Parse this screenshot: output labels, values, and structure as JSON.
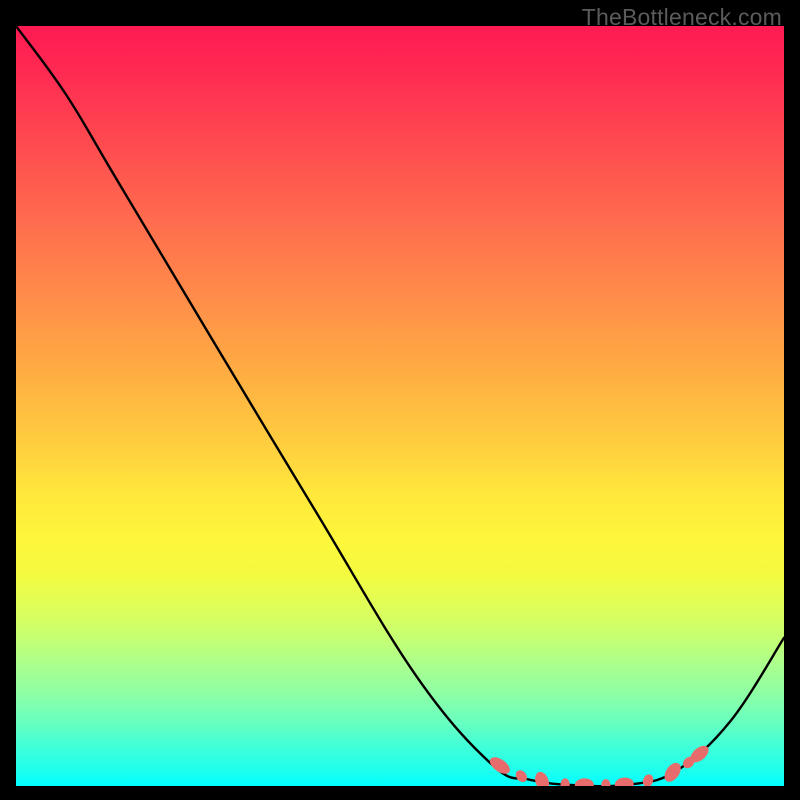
{
  "watermark": "TheBottleneck.com",
  "chart_data": {
    "type": "line",
    "title": "",
    "xlabel": "",
    "ylabel": "",
    "xlim": [
      0,
      100
    ],
    "ylim": [
      0,
      100
    ],
    "grid": false,
    "series": [
      {
        "name": "curve",
        "color": "#000000",
        "points": [
          {
            "x": 0.0,
            "y": 100.0
          },
          {
            "x": 6.5,
            "y": 91.0
          },
          {
            "x": 13.0,
            "y": 80.0
          },
          {
            "x": 26.0,
            "y": 58.0
          },
          {
            "x": 39.1,
            "y": 36.0
          },
          {
            "x": 52.1,
            "y": 14.5
          },
          {
            "x": 62.0,
            "y": 2.8
          },
          {
            "x": 67.0,
            "y": 0.8
          },
          {
            "x": 73.0,
            "y": 0.1
          },
          {
            "x": 80.0,
            "y": 0.2
          },
          {
            "x": 86.0,
            "y": 2.0
          },
          {
            "x": 93.0,
            "y": 8.5
          },
          {
            "x": 100.0,
            "y": 19.5
          }
        ]
      }
    ],
    "markers": [
      {
        "x": 63.0,
        "y": 2.7,
        "rx": 0.8,
        "ry": 1.5,
        "angle": -55
      },
      {
        "x": 65.8,
        "y": 1.3,
        "rx": 0.65,
        "ry": 0.85,
        "angle": -40
      },
      {
        "x": 68.5,
        "y": 0.6,
        "rx": 0.85,
        "ry": 1.3,
        "angle": -20
      },
      {
        "x": 71.5,
        "y": 0.25,
        "rx": 0.6,
        "ry": 0.75,
        "angle": 0
      },
      {
        "x": 74.0,
        "y": 0.15,
        "rx": 0.85,
        "ry": 1.25,
        "angle": 88
      },
      {
        "x": 76.8,
        "y": 0.15,
        "rx": 0.6,
        "ry": 0.75,
        "angle": 0
      },
      {
        "x": 79.2,
        "y": 0.25,
        "rx": 0.85,
        "ry": 1.25,
        "angle": 85
      },
      {
        "x": 82.3,
        "y": 0.7,
        "rx": 0.65,
        "ry": 0.85,
        "angle": 20
      },
      {
        "x": 85.5,
        "y": 1.8,
        "rx": 0.85,
        "ry": 1.4,
        "angle": 35
      },
      {
        "x": 87.6,
        "y": 3.1,
        "rx": 0.65,
        "ry": 0.85,
        "angle": 45
      },
      {
        "x": 89.0,
        "y": 4.2,
        "rx": 0.8,
        "ry": 1.4,
        "angle": 50
      }
    ],
    "marker_color": "#e86c6c",
    "background_gradient": {
      "top": "#ff1a52",
      "mid": "#fff03a",
      "bottom": "#00ffff"
    }
  }
}
